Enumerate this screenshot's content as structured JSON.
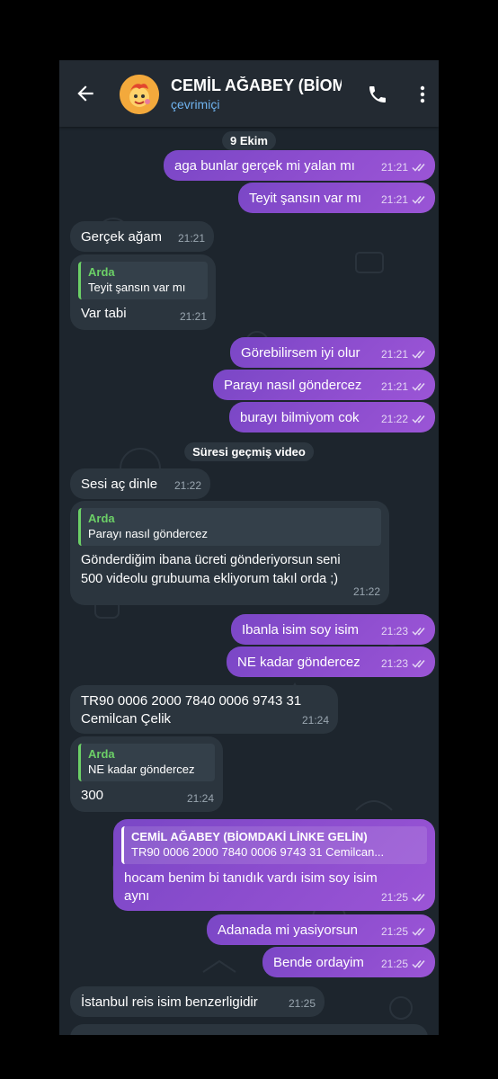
{
  "header": {
    "title": "CEMİL AĞABEY (BİOMDA",
    "status": "çevrimiçi"
  },
  "colors": {
    "background": "#1d252d",
    "header": "#232a32",
    "incoming_bubble": "#2b353e",
    "outgoing_bubble": "#8c4dce",
    "quote_accent": "#6cd067",
    "status_text": "#6fb3ef"
  },
  "chat": {
    "date_label": "9 Ekim",
    "service_label": "Süresi geçmiş video",
    "messages": [
      {
        "dir": "out",
        "text": "aga bunlar gerçek mi yalan mı",
        "time": "21:21",
        "status": "read"
      },
      {
        "dir": "out",
        "text": "Teyit şansın var mı",
        "time": "21:21",
        "status": "read"
      },
      {
        "dir": "in",
        "text": "Gerçek ağam",
        "time": "21:21"
      },
      {
        "dir": "in",
        "reply_name": "Arda",
        "reply_text": "Teyit şansın var mı",
        "text": "Var tabi",
        "time": "21:21"
      },
      {
        "dir": "out",
        "text": "Görebilirsem iyi olur",
        "time": "21:21",
        "status": "read"
      },
      {
        "dir": "out",
        "text": "Parayı nasıl göndercez",
        "time": "21:21",
        "status": "read"
      },
      {
        "dir": "out",
        "text": "burayı bilmiyom cok",
        "time": "21:22",
        "status": "read"
      },
      {
        "dir": "in",
        "text": "Sesi aç dinle",
        "time": "21:22"
      },
      {
        "dir": "in",
        "reply_name": "Arda",
        "reply_text": "Parayı nasıl göndercez",
        "line1": "Gönderdiğim ibana ücreti gönderiyorsun seni",
        "line2": "500 videolu grubuuma ekliyorum takıl orda  ;)",
        "time": "21:22"
      },
      {
        "dir": "out",
        "text": "Ibanla isim soy isim",
        "time": "21:23",
        "status": "read"
      },
      {
        "dir": "out",
        "text": "NE kadar göndercez",
        "time": "21:23",
        "status": "read"
      },
      {
        "dir": "in",
        "line1": "TR90 0006 2000 7840 0006 9743 31",
        "line2": "Cemilcan Çelik",
        "time": "21:24"
      },
      {
        "dir": "in",
        "reply_name": "Arda",
        "reply_text": "NE kadar göndercez",
        "text": "300",
        "time": "21:24"
      },
      {
        "dir": "out",
        "reply_name": "CEMİL AĞABEY (BİOMDAKİ LİNKE GELİN)",
        "reply_text": "TR90 0006 2000 7840 0006 9743 31 Cemilcan...",
        "line1": "hocam benim bi tanıdık vardı isim soy isim",
        "line2": "aynı",
        "time": "21:25",
        "status": "read"
      },
      {
        "dir": "out",
        "text": "Adanada mi yasiyorsun",
        "time": "21:25",
        "status": "read"
      },
      {
        "dir": "out",
        "text": "Bende ordayim",
        "time": "21:25",
        "status": "read"
      },
      {
        "dir": "in",
        "text": "İstanbul reis isim benzerligidir",
        "time": "21:25"
      }
    ]
  }
}
